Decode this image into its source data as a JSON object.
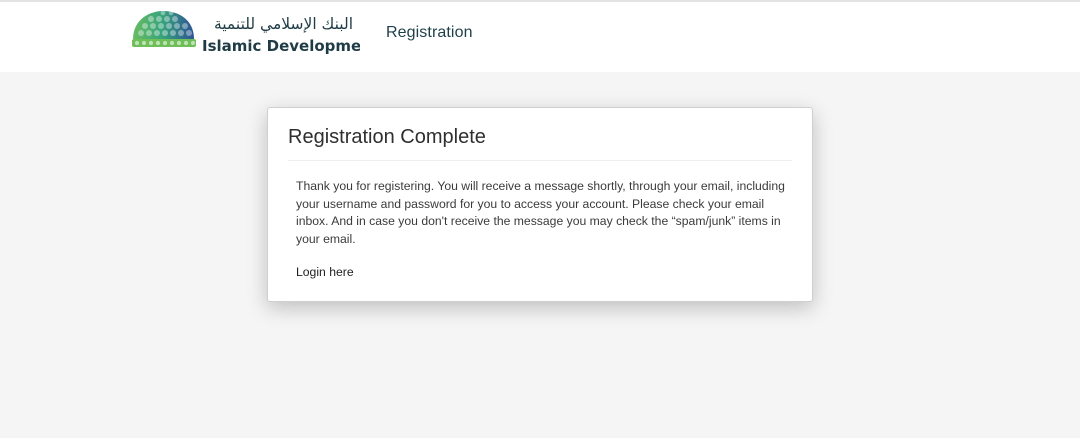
{
  "header": {
    "logo": {
      "arabic_text": "البنك الإسلامي للتنمية",
      "english_text": "Islamic Development Bank"
    },
    "nav_title": "Registration"
  },
  "card": {
    "title": "Registration Complete",
    "message": "Thank you for registering. You will receive a message shortly, through your email, including your username and password for you to access your account. Please check your email inbox. And in case you don't receive the message you may check the “spam/junk” items in your email.",
    "login_link": "Login here"
  },
  "colors": {
    "page_background": "#f5f5f5",
    "header_background": "#ffffff",
    "nav_title": "#1e3f4a",
    "logo_text": "#1f3c46",
    "logo_dome_green": "#49a84f",
    "logo_dome_blue": "#274b8f"
  }
}
